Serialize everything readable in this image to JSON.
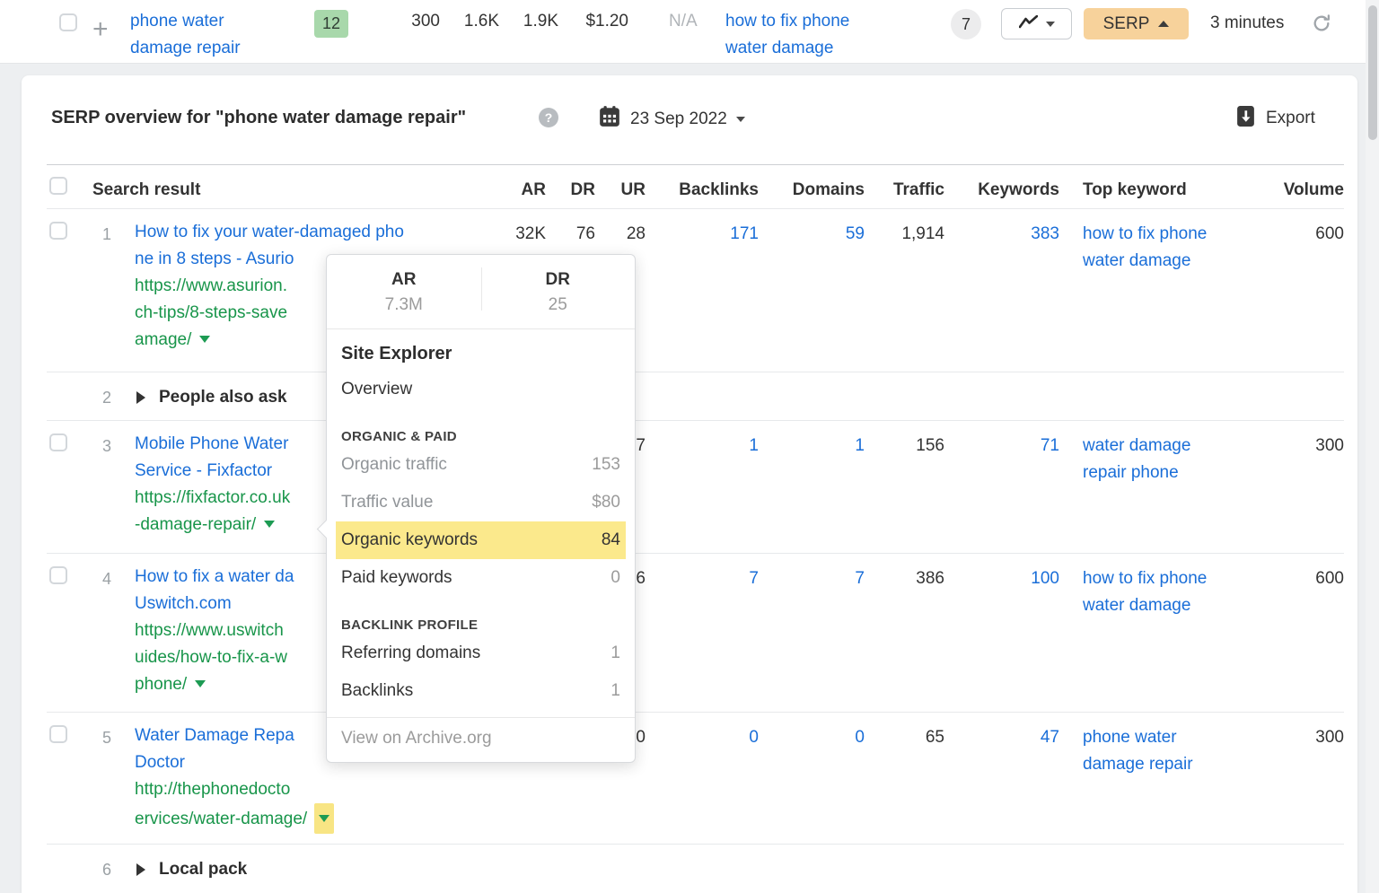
{
  "colors": {
    "link_blue": "#1a6ed8",
    "url_green": "#18954a",
    "kd_badge_bg": "#a8d8ab",
    "serp_button_bg": "#f7d29b",
    "highlight_yellow": "#fbe98c"
  },
  "keyword_row": {
    "keyword_lines": [
      "phone water",
      "damage repair"
    ],
    "kd": "12",
    "metrics": [
      "300",
      "1.6K",
      "1.9K",
      "$1.20"
    ],
    "na_metric": "N/A",
    "parent_keyword_lines": [
      "how to fix phone",
      "water damage"
    ],
    "serp_features_count": "7",
    "serp_button_label": "SERP",
    "updated": "3 minutes"
  },
  "panel": {
    "title": "SERP overview for \"phone water damage repair\"",
    "date": "23 Sep 2022",
    "export_label": "Export"
  },
  "table": {
    "headers": {
      "search_result": "Search result",
      "ar": "AR",
      "dr": "DR",
      "ur": "UR",
      "backlinks": "Backlinks",
      "domains": "Domains",
      "traffic": "Traffic",
      "keywords": "Keywords",
      "top_keyword": "Top keyword",
      "volume": "Volume"
    },
    "rows": [
      {
        "num": "1",
        "title_lines": [
          "How to fix your water-damaged pho",
          "ne in 8 steps - Asurio"
        ],
        "url_lines": [
          "https://www.asurion.",
          "ch-tips/8-steps-save",
          "amage/"
        ],
        "ar": "32K",
        "dr": "76",
        "ur": "28",
        "backlinks": "171",
        "domains": "59",
        "traffic": "1,914",
        "keywords": "383",
        "top_keyword_lines": [
          "how to fix phone",
          "water damage"
        ],
        "volume": "600"
      },
      {
        "num": "2",
        "label": "People also ask"
      },
      {
        "num": "3",
        "title_lines": [
          "Mobile Phone Water",
          "Service - Fixfactor"
        ],
        "url_lines": [
          "https://fixfactor.co.uk",
          "-damage-repair/"
        ],
        "ur": "7",
        "backlinks": "1",
        "domains": "1",
        "traffic": "156",
        "keywords": "71",
        "top_keyword_lines": [
          "water damage",
          "repair phone"
        ],
        "volume": "300"
      },
      {
        "num": "4",
        "title_lines": [
          "How to fix a water da",
          "Uswitch.com"
        ],
        "url_lines": [
          "https://www.uswitch",
          "uides/how-to-fix-a-w",
          "phone/"
        ],
        "ur": "6",
        "backlinks": "7",
        "domains": "7",
        "traffic": "386",
        "keywords": "100",
        "top_keyword_lines": [
          "how to fix phone",
          "water damage"
        ],
        "volume": "600"
      },
      {
        "num": "5",
        "title_lines": [
          "Water Damage Repa",
          "Doctor"
        ],
        "url_lines": [
          "http://thephonedocto",
          "ervices/water-damage/"
        ],
        "ur": "0",
        "backlinks": "0",
        "domains": "0",
        "traffic": "65",
        "keywords": "47",
        "top_keyword_lines": [
          "phone water",
          "damage repair"
        ],
        "volume": "300"
      },
      {
        "num": "6",
        "label": "Local pack"
      }
    ]
  },
  "popup": {
    "ar_label": "AR",
    "ar_value": "7.3M",
    "dr_label": "DR",
    "dr_value": "25",
    "site_explorer": "Site Explorer",
    "overview": "Overview",
    "organic_paid_heading": "ORGANIC & PAID",
    "organic_traffic_label": "Organic traffic",
    "organic_traffic_value": "153",
    "traffic_value_label": "Traffic value",
    "traffic_value_value": "$80",
    "organic_keywords_label": "Organic keywords",
    "organic_keywords_value": "84",
    "paid_keywords_label": "Paid keywords",
    "paid_keywords_value": "0",
    "backlink_profile_heading": "BACKLINK PROFILE",
    "referring_domains_label": "Referring domains",
    "referring_domains_value": "1",
    "backlinks_label": "Backlinks",
    "backlinks_value": "1",
    "archive_link": "View on Archive.org"
  }
}
